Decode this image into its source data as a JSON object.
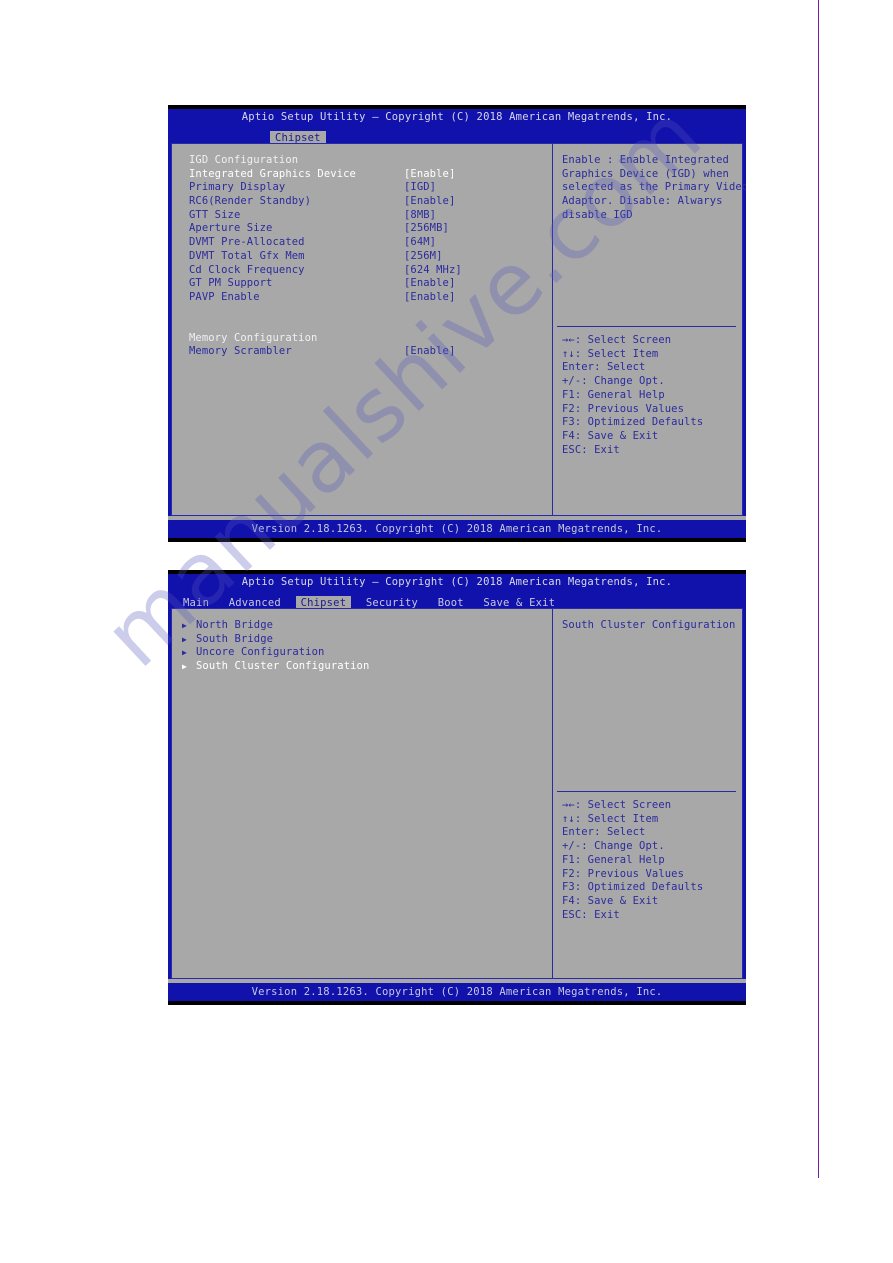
{
  "page": {
    "rule_color": "#7b1fa2",
    "watermark": "manualshive.com"
  },
  "screens": [
    {
      "title": "Aptio Setup Utility – Copyright (C) 2018 American Megatrends, Inc.",
      "menu": [
        {
          "label": "Chipset",
          "active": true
        }
      ],
      "rows": [
        {
          "label": "IGD Configuration",
          "value": "",
          "kind": "heading"
        },
        {
          "label": "Integrated Graphics Device",
          "value": "[Enable]",
          "kind": "selected"
        },
        {
          "label": "Primary Display",
          "value": "[IGD]",
          "kind": "item"
        },
        {
          "label": "RC6(Render Standby)",
          "value": "[Enable]",
          "kind": "item"
        },
        {
          "label": "GTT Size",
          "value": "[8MB]",
          "kind": "item"
        },
        {
          "label": "Aperture Size",
          "value": "[256MB]",
          "kind": "item"
        },
        {
          "label": "DVMT Pre-Allocated",
          "value": "[64M]",
          "kind": "item"
        },
        {
          "label": "DVMT Total Gfx Mem",
          "value": "[256M]",
          "kind": "item"
        },
        {
          "label": "Cd Clock Frequency",
          "value": "[624 MHz]",
          "kind": "item"
        },
        {
          "label": "GT PM Support",
          "value": "[Enable]",
          "kind": "item"
        },
        {
          "label": "PAVP Enable",
          "value": "[Enable]",
          "kind": "item"
        },
        {
          "label": "",
          "value": "",
          "kind": "spacer"
        },
        {
          "label": "Memory Configuration",
          "value": "",
          "kind": "heading"
        },
        {
          "label": "Memory Scrambler",
          "value": "[Enable]",
          "kind": "item"
        }
      ],
      "help": [
        "Enable : Enable Integrated",
        "Graphics Device (IGD) when",
        "selected as the Primary Video",
        "Adaptor. Disable: Alwarys",
        "disable IGD"
      ],
      "hotkeys": [
        "→←: Select Screen",
        "↑↓: Select Item",
        "Enter: Select",
        "+/-: Change Opt.",
        "F1: General Help",
        "F2: Previous Values",
        "F3: Optimized Defaults",
        "F4: Save & Exit",
        "ESC: Exit"
      ],
      "version": "Version 2.18.1263. Copyright (C) 2018 American Megatrends, Inc."
    },
    {
      "title": "Aptio Setup Utility – Copyright (C) 2018 American Megatrends, Inc.",
      "menu": [
        {
          "label": "Main",
          "active": false
        },
        {
          "label": "Advanced",
          "active": false
        },
        {
          "label": "Chipset",
          "active": true
        },
        {
          "label": "Security",
          "active": false
        },
        {
          "label": "Boot",
          "active": false
        },
        {
          "label": "Save & Exit",
          "active": false
        }
      ],
      "rows": [
        {
          "label": "North Bridge",
          "value": "",
          "kind": "nav"
        },
        {
          "label": "South Bridge",
          "value": "",
          "kind": "nav"
        },
        {
          "label": "Uncore Configuration",
          "value": "",
          "kind": "nav"
        },
        {
          "label": "South Cluster Configuration",
          "value": "",
          "kind": "nav-selected"
        }
      ],
      "help": [
        "South Cluster Configuration"
      ],
      "hotkeys": [
        "→←: Select Screen",
        "↑↓: Select Item",
        "Enter: Select",
        "+/-: Change Opt.",
        "F1: General Help",
        "F2: Previous Values",
        "F3: Optimized Defaults",
        "F4: Save & Exit",
        "ESC: Exit"
      ],
      "version": "Version 2.18.1263. Copyright (C) 2018 American Megatrends, Inc."
    }
  ]
}
